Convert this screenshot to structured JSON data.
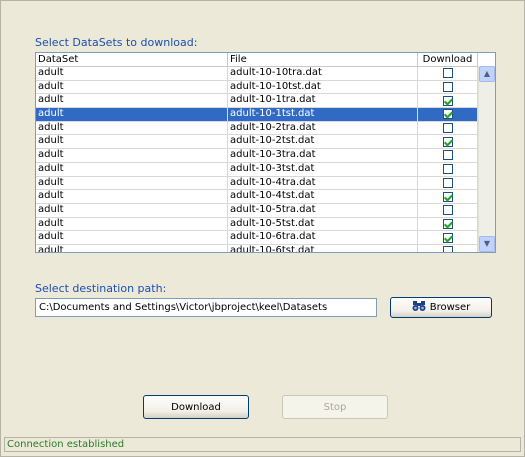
{
  "datasets": {
    "label": "Select DataSets to download:",
    "columns": [
      "DataSet",
      "File",
      "Download"
    ],
    "rows": [
      {
        "dataset": "adult",
        "file": "adult-10-10tra.dat",
        "checked": false,
        "selected": false
      },
      {
        "dataset": "adult",
        "file": "adult-10-10tst.dat",
        "checked": false,
        "selected": false
      },
      {
        "dataset": "adult",
        "file": "adult-10-1tra.dat",
        "checked": true,
        "selected": false
      },
      {
        "dataset": "adult",
        "file": "adult-10-1tst.dat",
        "checked": true,
        "selected": true
      },
      {
        "dataset": "adult",
        "file": "adult-10-2tra.dat",
        "checked": false,
        "selected": false
      },
      {
        "dataset": "adult",
        "file": "adult-10-2tst.dat",
        "checked": true,
        "selected": false
      },
      {
        "dataset": "adult",
        "file": "adult-10-3tra.dat",
        "checked": false,
        "selected": false
      },
      {
        "dataset": "adult",
        "file": "adult-10-3tst.dat",
        "checked": false,
        "selected": false
      },
      {
        "dataset": "adult",
        "file": "adult-10-4tra.dat",
        "checked": false,
        "selected": false
      },
      {
        "dataset": "adult",
        "file": "adult-10-4tst.dat",
        "checked": true,
        "selected": false
      },
      {
        "dataset": "adult",
        "file": "adult-10-5tra.dat",
        "checked": false,
        "selected": false
      },
      {
        "dataset": "adult",
        "file": "adult-10-5tst.dat",
        "checked": true,
        "selected": false
      },
      {
        "dataset": "adult",
        "file": "adult-10-6tra.dat",
        "checked": true,
        "selected": false
      },
      {
        "dataset": "adult",
        "file": "adult-10-6tst.dat",
        "checked": false,
        "selected": false
      }
    ]
  },
  "destination": {
    "label": "Select destination path:",
    "path": "C:\\Documents and Settings\\Victor\\jbproject\\keel\\Datasets",
    "browser_label": "Browser",
    "browser_icon": "binoculars-icon"
  },
  "actions": {
    "download_label": "Download",
    "stop_label": "Stop"
  },
  "status": {
    "text": "Connection established",
    "color": "#2a7b2a"
  },
  "colors": {
    "accent_label": "#1a4fb0",
    "selection": "#316ac5",
    "check": "#21a121"
  }
}
